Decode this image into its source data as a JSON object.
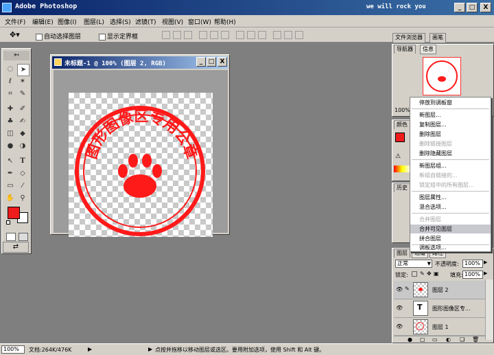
{
  "window": {
    "title": "Adobe Photoshop",
    "motto": "we will rock you",
    "minimize": "_",
    "maximize": "□",
    "close": "X"
  },
  "menu": [
    "文件(F)",
    "编辑(E)",
    "图像(I)",
    "图层(L)",
    "选择(S)",
    "滤镜(T)",
    "视图(V)",
    "窗口(W)",
    "帮助(H)"
  ],
  "options": {
    "auto_select": "自动选择图层",
    "show_bounds": "显示定界框"
  },
  "panel_well": {
    "tab1": "文件浏览器",
    "tab2": "画笔"
  },
  "document": {
    "title": "未标题-1 @ 100% (图层 2, RGB)"
  },
  "seal": {
    "text": "图形图像区专用公章",
    "color": "#ff1a1a"
  },
  "navigator": {
    "tabs": [
      "导航器",
      "信息"
    ],
    "zoom": "100%"
  },
  "color_panel": {
    "tab": "颜色"
  },
  "history_panel": {
    "tab": "历史"
  },
  "layers_panel": {
    "tabs": [
      "图层",
      "通道",
      "路径"
    ],
    "blend_mode": "正常",
    "opacity_label": "不透明度:",
    "opacity": "100%",
    "lock_label": "锁定:",
    "fill_label": "填充:",
    "fill": "100%",
    "layers": [
      {
        "name": "图层 2",
        "selected": true
      },
      {
        "name": "图形图像区专...",
        "selected": false
      },
      {
        "name": "图层 1",
        "selected": false
      }
    ]
  },
  "context_menu": [
    {
      "label": "停放到调板窗",
      "disabled": false
    },
    {
      "label": "新图层...",
      "disabled": false
    },
    {
      "label": "复制图层...",
      "disabled": false
    },
    {
      "label": "删除图层",
      "disabled": false
    },
    {
      "label": "删除链接图层",
      "disabled": true
    },
    {
      "label": "删除隐藏图层",
      "disabled": false
    },
    {
      "label": "新图层组...",
      "disabled": false
    },
    {
      "label": "新组自链接的...",
      "disabled": true
    },
    {
      "label": "锁定组中的所有图层...",
      "disabled": true
    },
    {
      "label": "图层属性...",
      "disabled": false
    },
    {
      "label": "混合选项...",
      "disabled": false
    },
    {
      "label": "合并图层",
      "disabled": true
    },
    {
      "label": "合并可见图层",
      "disabled": false,
      "highlighted": true
    },
    {
      "label": "拼合图层",
      "disabled": false
    },
    {
      "label": "调板选项...",
      "disabled": false
    }
  ],
  "status": {
    "zoom": "100%",
    "doc_size": "文档:264K/476K",
    "hint": "点按并拖移以移动图层或选区。要用附加选项，使用 Shift 和 Alt 键。"
  },
  "colors": {
    "foreground": "#ee1c1c",
    "background": "#ffffff",
    "titlebar": "#0a246a"
  }
}
